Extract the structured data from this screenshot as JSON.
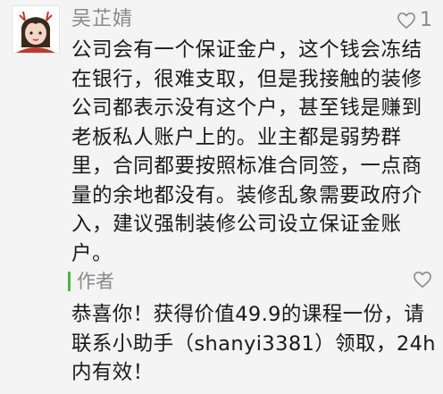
{
  "comment": {
    "author": "吴芷婧",
    "like_count": "1",
    "text": "公司会有一个保证金户，这个钱会冻结在银行，很难支取，但是我接触的装修公司都表示没有这个户，甚至钱是赚到老板私人账户上的。业主都是弱势群里，合同都要按照标准合同签，一点商量的余地都没有。装修乱象需要政府介入，建议强制装修公司设立保证金账户。",
    "avatar_icon": "cartoon-girl-avatar-icon",
    "like_icon": "heart-icon"
  },
  "reply": {
    "author": "作者",
    "text": "恭喜你！获得价值49.9的课程一份，请联系小助手（shanyi3381）领取，24h内有效！",
    "like_icon": "heart-icon"
  },
  "colors": {
    "background": "#f4f4f4",
    "meta_gray": "#8a8a8a",
    "author_bar_green": "#4fb342",
    "text": "#1a1a1a"
  }
}
